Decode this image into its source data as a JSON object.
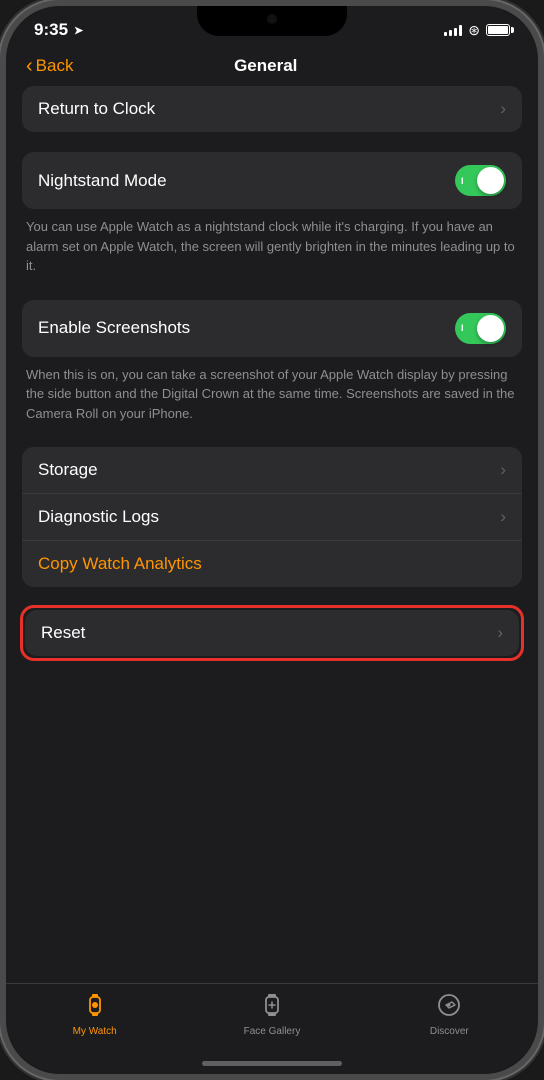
{
  "statusBar": {
    "time": "9:35",
    "locationIcon": "➤"
  },
  "navBar": {
    "backLabel": "Back",
    "title": "General"
  },
  "sections": {
    "returnToClock": {
      "label": "Return to Clock"
    },
    "nightstandMode": {
      "label": "Nightstand Mode",
      "toggleOn": true,
      "toggleText": "I",
      "description": "You can use Apple Watch as a nightstand clock while it's charging. If you have an alarm set on Apple Watch, the screen will gently brighten in the minutes leading up to it."
    },
    "enableScreenshots": {
      "label": "Enable Screenshots",
      "toggleOn": true,
      "toggleText": "I",
      "description": "When this is on, you can take a screenshot of your Apple Watch display by pressing the side button and the Digital Crown at the same time. Screenshots are saved in the Camera Roll on your iPhone."
    },
    "storage": {
      "label": "Storage"
    },
    "diagnosticLogs": {
      "label": "Diagnostic Logs"
    },
    "copyWatchAnalytics": {
      "label": "Copy Watch Analytics"
    },
    "reset": {
      "label": "Reset"
    }
  },
  "tabBar": {
    "tabs": [
      {
        "id": "my-watch",
        "label": "My Watch",
        "active": true
      },
      {
        "id": "face-gallery",
        "label": "Face Gallery",
        "active": false
      },
      {
        "id": "discover",
        "label": "Discover",
        "active": false
      }
    ]
  }
}
